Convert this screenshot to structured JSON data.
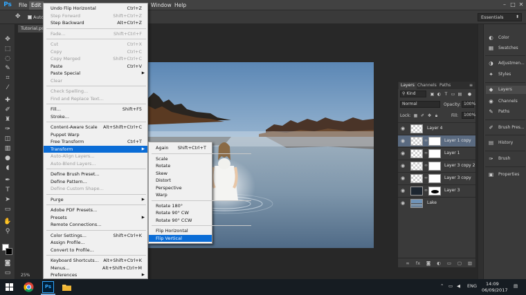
{
  "app": {
    "logo": "Ps"
  },
  "menubar": {
    "items": [
      {
        "label": "File"
      },
      {
        "label": "Edit",
        "active": true
      },
      {
        "label": "Window"
      },
      {
        "label": "Help"
      }
    ],
    "window_controls": [
      "–",
      "□",
      "✕"
    ]
  },
  "options_bar": {
    "auto_label": "Auto",
    "workspace": "Essentials"
  },
  "document": {
    "tab_label": "Tutorial.psd",
    "zoom": "25%"
  },
  "edit_menu": {
    "items": [
      {
        "label": "Undo Flip Horizontal",
        "shortcut": "Ctrl+Z"
      },
      {
        "label": "Step Forward",
        "shortcut": "Shift+Ctrl+Z",
        "disabled": true
      },
      {
        "label": "Step Backward",
        "shortcut": "Alt+Ctrl+Z"
      },
      {
        "sep": true
      },
      {
        "label": "Fade...",
        "shortcut": "Shift+Ctrl+F",
        "disabled": true
      },
      {
        "sep": true
      },
      {
        "label": "Cut",
        "shortcut": "Ctrl+X",
        "disabled": true
      },
      {
        "label": "Copy",
        "shortcut": "Ctrl+C",
        "disabled": true
      },
      {
        "label": "Copy Merged",
        "shortcut": "Shift+Ctrl+C",
        "disabled": true
      },
      {
        "label": "Paste",
        "shortcut": "Ctrl+V"
      },
      {
        "label": "Paste Special",
        "submenu": true
      },
      {
        "label": "Clear",
        "disabled": true
      },
      {
        "sep": true
      },
      {
        "label": "Check Spelling...",
        "disabled": true
      },
      {
        "label": "Find and Replace Text...",
        "disabled": true
      },
      {
        "sep": true
      },
      {
        "label": "Fill...",
        "shortcut": "Shift+F5"
      },
      {
        "label": "Stroke..."
      },
      {
        "sep": true
      },
      {
        "label": "Content-Aware Scale",
        "shortcut": "Alt+Shift+Ctrl+C"
      },
      {
        "label": "Puppet Warp"
      },
      {
        "label": "Free Transform",
        "shortcut": "Ctrl+T"
      },
      {
        "label": "Transform",
        "submenu": true,
        "highlight": true
      },
      {
        "label": "Auto-Align Layers...",
        "disabled": true
      },
      {
        "label": "Auto-Blend Layers...",
        "disabled": true
      },
      {
        "sep": true
      },
      {
        "label": "Define Brush Preset..."
      },
      {
        "label": "Define Pattern..."
      },
      {
        "label": "Define Custom Shape...",
        "disabled": true
      },
      {
        "sep": true
      },
      {
        "label": "Purge",
        "submenu": true
      },
      {
        "sep": true
      },
      {
        "label": "Adobe PDF Presets..."
      },
      {
        "label": "Presets",
        "submenu": true
      },
      {
        "label": "Remote Connections..."
      },
      {
        "sep": true
      },
      {
        "label": "Color Settings...",
        "shortcut": "Shift+Ctrl+K"
      },
      {
        "label": "Assign Profile..."
      },
      {
        "label": "Convert to Profile..."
      },
      {
        "sep": true
      },
      {
        "label": "Keyboard Shortcuts...",
        "shortcut": "Alt+Shift+Ctrl+K"
      },
      {
        "label": "Menus...",
        "shortcut": "Alt+Shift+Ctrl+M"
      },
      {
        "label": "Preferences",
        "submenu": true
      }
    ]
  },
  "transform_menu": {
    "items": [
      {
        "label": "Again",
        "shortcut": "Shift+Ctrl+T"
      },
      {
        "sep": true
      },
      {
        "label": "Scale"
      },
      {
        "label": "Rotate"
      },
      {
        "label": "Skew"
      },
      {
        "label": "Distort"
      },
      {
        "label": "Perspective"
      },
      {
        "label": "Warp"
      },
      {
        "sep": true
      },
      {
        "label": "Rotate 180°"
      },
      {
        "label": "Rotate 90° CW"
      },
      {
        "label": "Rotate 90° CCW"
      },
      {
        "sep": true
      },
      {
        "label": "Flip Horizontal"
      },
      {
        "label": "Flip Vertical",
        "highlight": true
      }
    ]
  },
  "layers_panel": {
    "tabs": [
      "Layers",
      "Channels",
      "Paths"
    ],
    "kind_label": "Kind",
    "blend_mode": "Normal",
    "opacity_label": "Opacity:",
    "opacity_value": "100%",
    "lock_label": "Lock:",
    "fill_label": "Fill:",
    "fill_value": "100%",
    "layers": [
      {
        "name": "Layer 4",
        "thumb": "checker",
        "mask": false
      },
      {
        "name": "Layer 1 copy",
        "thumb": "checker",
        "mask": true,
        "selected": true
      },
      {
        "name": "Layer 1",
        "thumb": "checker",
        "mask": true
      },
      {
        "name": "Layer 3 copy 2",
        "thumb": "checker",
        "mask": true
      },
      {
        "name": "Layer 3 copy",
        "thumb": "checker",
        "mask": true
      },
      {
        "name": "Layer 3",
        "thumb": "dark",
        "mask": true
      },
      {
        "name": "Lake",
        "thumb": "lake",
        "mask": false
      }
    ],
    "footer_icons": [
      "link-icon",
      "fx-icon",
      "mask-icon",
      "adjustment-icon",
      "group-icon",
      "new-layer-icon",
      "trash-icon"
    ]
  },
  "dock": {
    "items": [
      {
        "label": "Color",
        "icon": "◐",
        "name": "color"
      },
      {
        "label": "Swatches",
        "icon": "▦",
        "name": "swatches"
      },
      {
        "label": "Adjustmen...",
        "icon": "◑",
        "name": "adjustments"
      },
      {
        "label": "Styles",
        "icon": "✦",
        "name": "styles"
      },
      {
        "label": "Layers",
        "icon": "◆",
        "name": "layers",
        "active": true
      },
      {
        "label": "Channels",
        "icon": "◉",
        "name": "channels"
      },
      {
        "label": "Paths",
        "icon": "✎",
        "name": "paths"
      },
      {
        "label": "Brush Pres...",
        "icon": "✐",
        "name": "brush-presets"
      },
      {
        "label": "History",
        "icon": "▤",
        "name": "history"
      },
      {
        "label": "Brush",
        "icon": "✑",
        "name": "brush"
      },
      {
        "label": "Properties",
        "icon": "▣",
        "name": "properties"
      }
    ]
  },
  "taskbar": {
    "ps_label": "Ps",
    "lang": "ENG",
    "time": "14:09",
    "date": "06/09/2017"
  }
}
